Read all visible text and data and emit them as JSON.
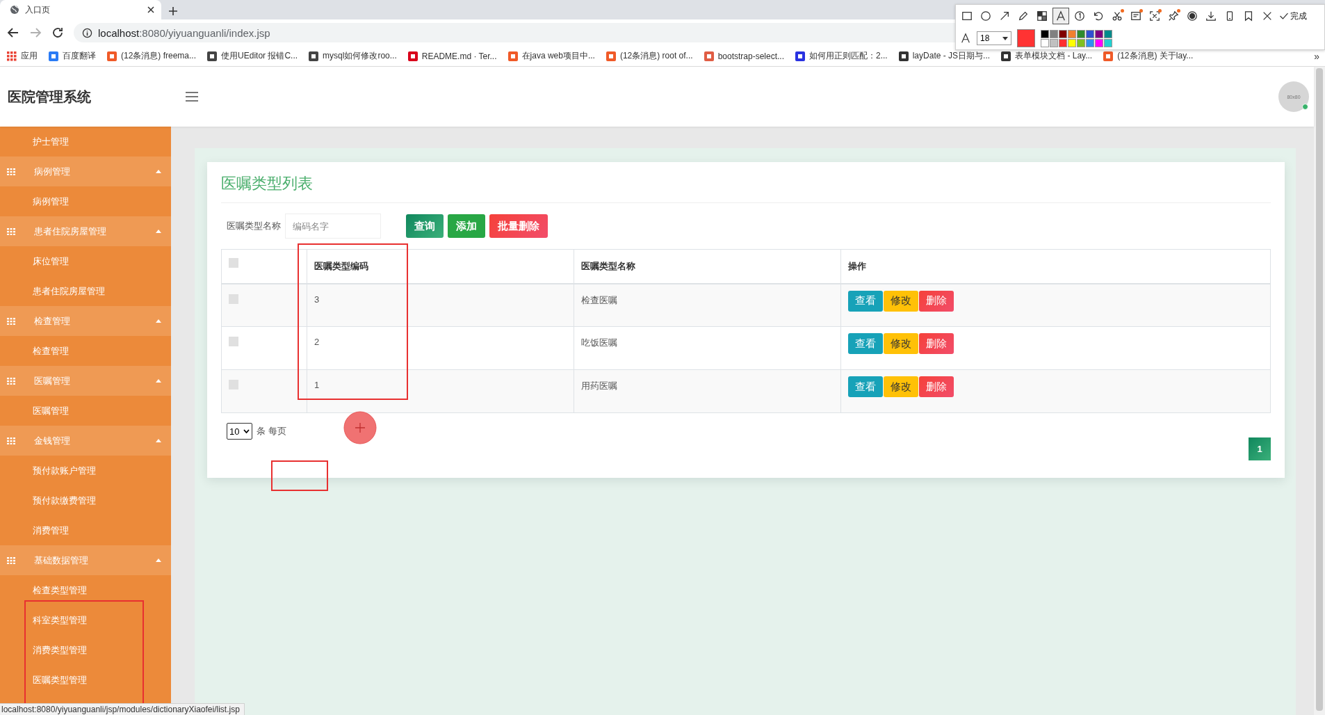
{
  "browser": {
    "tab": {
      "title": "入口页"
    },
    "address": {
      "host": "localhost",
      "path": ":8080/yiyuanguanli/index.jsp"
    },
    "bookmarks": [
      {
        "label": "应用",
        "color": "#ea4335"
      },
      {
        "label": "百度翻译",
        "color": "#2a7bf5"
      },
      {
        "label": "(12条消息) freema...",
        "color": "#f05a28"
      },
      {
        "label": "使用UEditor 报错C...",
        "color": "#444444"
      },
      {
        "label": "mysql如何修改roo...",
        "color": "#444444"
      },
      {
        "label": "README.md · Ter...",
        "color": "#d9001b"
      },
      {
        "label": "在java web项目中...",
        "color": "#f05a28"
      },
      {
        "label": "(12条消息) root of...",
        "color": "#f05a28"
      },
      {
        "label": "bootstrap-select...",
        "color": "#e05d44"
      },
      {
        "label": "如何用正则匹配：2...",
        "color": "#2932e1"
      },
      {
        "label": "layDate - JS日期与...",
        "color": "#333333"
      },
      {
        "label": "表单模块文档 - Lay...",
        "color": "#333333"
      },
      {
        "label": "(12条消息) 关于lay...",
        "color": "#f05a28"
      }
    ],
    "more": "»"
  },
  "markup_toolbar": {
    "tools": [
      {
        "kind": "rect",
        "selected": false,
        "badge": false
      },
      {
        "kind": "circle",
        "selected": false,
        "badge": false
      },
      {
        "kind": "arrow",
        "selected": false,
        "badge": false
      },
      {
        "kind": "pencil",
        "selected": false,
        "badge": false
      },
      {
        "kind": "mosaic",
        "selected": false,
        "badge": false
      },
      {
        "kind": "text",
        "selected": true,
        "badge": false
      },
      {
        "kind": "number",
        "selected": false,
        "badge": false
      },
      {
        "kind": "undo",
        "selected": false,
        "badge": false
      },
      {
        "kind": "scissors",
        "selected": false,
        "badge": true
      },
      {
        "kind": "ocr",
        "selected": false,
        "badge": true
      },
      {
        "kind": "capture",
        "selected": false,
        "badge": true
      },
      {
        "kind": "pin",
        "selected": false,
        "badge": true
      },
      {
        "kind": "record",
        "selected": false,
        "badge": false
      },
      {
        "kind": "download",
        "selected": false,
        "badge": false
      },
      {
        "kind": "phone",
        "selected": false,
        "badge": false
      },
      {
        "kind": "bookmark",
        "selected": false,
        "badge": false
      },
      {
        "kind": "close",
        "selected": false,
        "badge": false
      }
    ],
    "done": "完成",
    "size": "18",
    "current": {
      "color": "#ff3333"
    },
    "palette": [
      {
        "color": "#000000"
      },
      {
        "color": "#808080"
      },
      {
        "color": "#800000"
      },
      {
        "color": "#f08030"
      },
      {
        "color": "#2e8b2e"
      },
      {
        "color": "#3050d0"
      },
      {
        "color": "#800080"
      },
      {
        "color": "#008b8b"
      },
      {
        "color": "#ffffff"
      },
      {
        "color": "#c0c0c0"
      },
      {
        "color": "#ff3030"
      },
      {
        "color": "#ffff00"
      },
      {
        "color": "#80c020"
      },
      {
        "color": "#3090f0"
      },
      {
        "color": "#ff00ff"
      },
      {
        "color": "#20d0d0"
      }
    ]
  },
  "app": {
    "title": "医院管理系统",
    "avatar": "80x80"
  },
  "sidebar": {
    "items": [
      {
        "kind": "link",
        "label": "护士管理"
      },
      {
        "kind": "group",
        "label": "病例管理",
        "expanded": true,
        "children": [
          {
            "kind": "link",
            "label": "病例管理"
          }
        ]
      },
      {
        "kind": "group",
        "label": "患者住院房屋管理",
        "expanded": true,
        "children": [
          {
            "kind": "link",
            "label": "床位管理"
          },
          {
            "kind": "link",
            "label": "患者住院房屋管理"
          }
        ]
      },
      {
        "kind": "group",
        "label": "检查管理",
        "expanded": true,
        "children": [
          {
            "kind": "link",
            "label": "检查管理"
          }
        ]
      },
      {
        "kind": "group",
        "label": "医嘱管理",
        "expanded": true,
        "children": [
          {
            "kind": "link",
            "label": "医嘱管理"
          }
        ]
      },
      {
        "kind": "group",
        "label": "金钱管理",
        "expanded": true,
        "children": [
          {
            "kind": "link",
            "label": "预付款账户管理"
          },
          {
            "kind": "link",
            "label": "预付款缴费管理"
          },
          {
            "kind": "link",
            "label": "消费管理"
          }
        ]
      },
      {
        "kind": "group",
        "label": "基础数据管理",
        "expanded": true,
        "children": [
          {
            "kind": "link",
            "label": "检查类型管理"
          },
          {
            "kind": "link",
            "label": "科室类型管理"
          },
          {
            "kind": "link",
            "label": "消费类型管理"
          },
          {
            "kind": "link",
            "label": "医嘱类型管理"
          }
        ]
      }
    ]
  },
  "card": {
    "title": "医嘱类型列表",
    "search": {
      "label": "医嘱类型名称",
      "placeholder": "编码名字"
    },
    "buttons": [
      {
        "kind": "search",
        "label": "查询"
      },
      {
        "kind": "add",
        "label": "添加"
      },
      {
        "kind": "batch-delete",
        "label": "批量删除"
      }
    ],
    "table": {
      "header_checked": false,
      "columns": [
        "医嘱类型编码",
        "医嘱类型名称",
        "操作"
      ],
      "rows": [
        {
          "checked": false,
          "code": "3",
          "name": "检查医嘱",
          "actions": [
            {
              "kind": "view",
              "label": "查看"
            },
            {
              "kind": "edit",
              "label": "修改"
            },
            {
              "kind": "delete",
              "label": "删除"
            }
          ]
        },
        {
          "checked": false,
          "code": "2",
          "name": "吃饭医嘱",
          "actions": [
            {
              "kind": "view",
              "label": "查看"
            },
            {
              "kind": "edit",
              "label": "修改"
            },
            {
              "kind": "delete",
              "label": "删除"
            }
          ]
        },
        {
          "checked": false,
          "code": "1",
          "name": "用药医嘱",
          "actions": [
            {
              "kind": "view",
              "label": "查看"
            },
            {
              "kind": "edit",
              "label": "修改"
            },
            {
              "kind": "delete",
              "label": "删除"
            }
          ]
        }
      ]
    },
    "pagination": {
      "page_size": "10",
      "page_size_suffix": "条 每页",
      "pages": [
        {
          "label": "1",
          "selected": true
        }
      ]
    }
  },
  "status_bar": {
    "url": "localhost:8080/yiyuanguanli/jsp/modules/dictionaryXiaofei/list.jsp"
  }
}
